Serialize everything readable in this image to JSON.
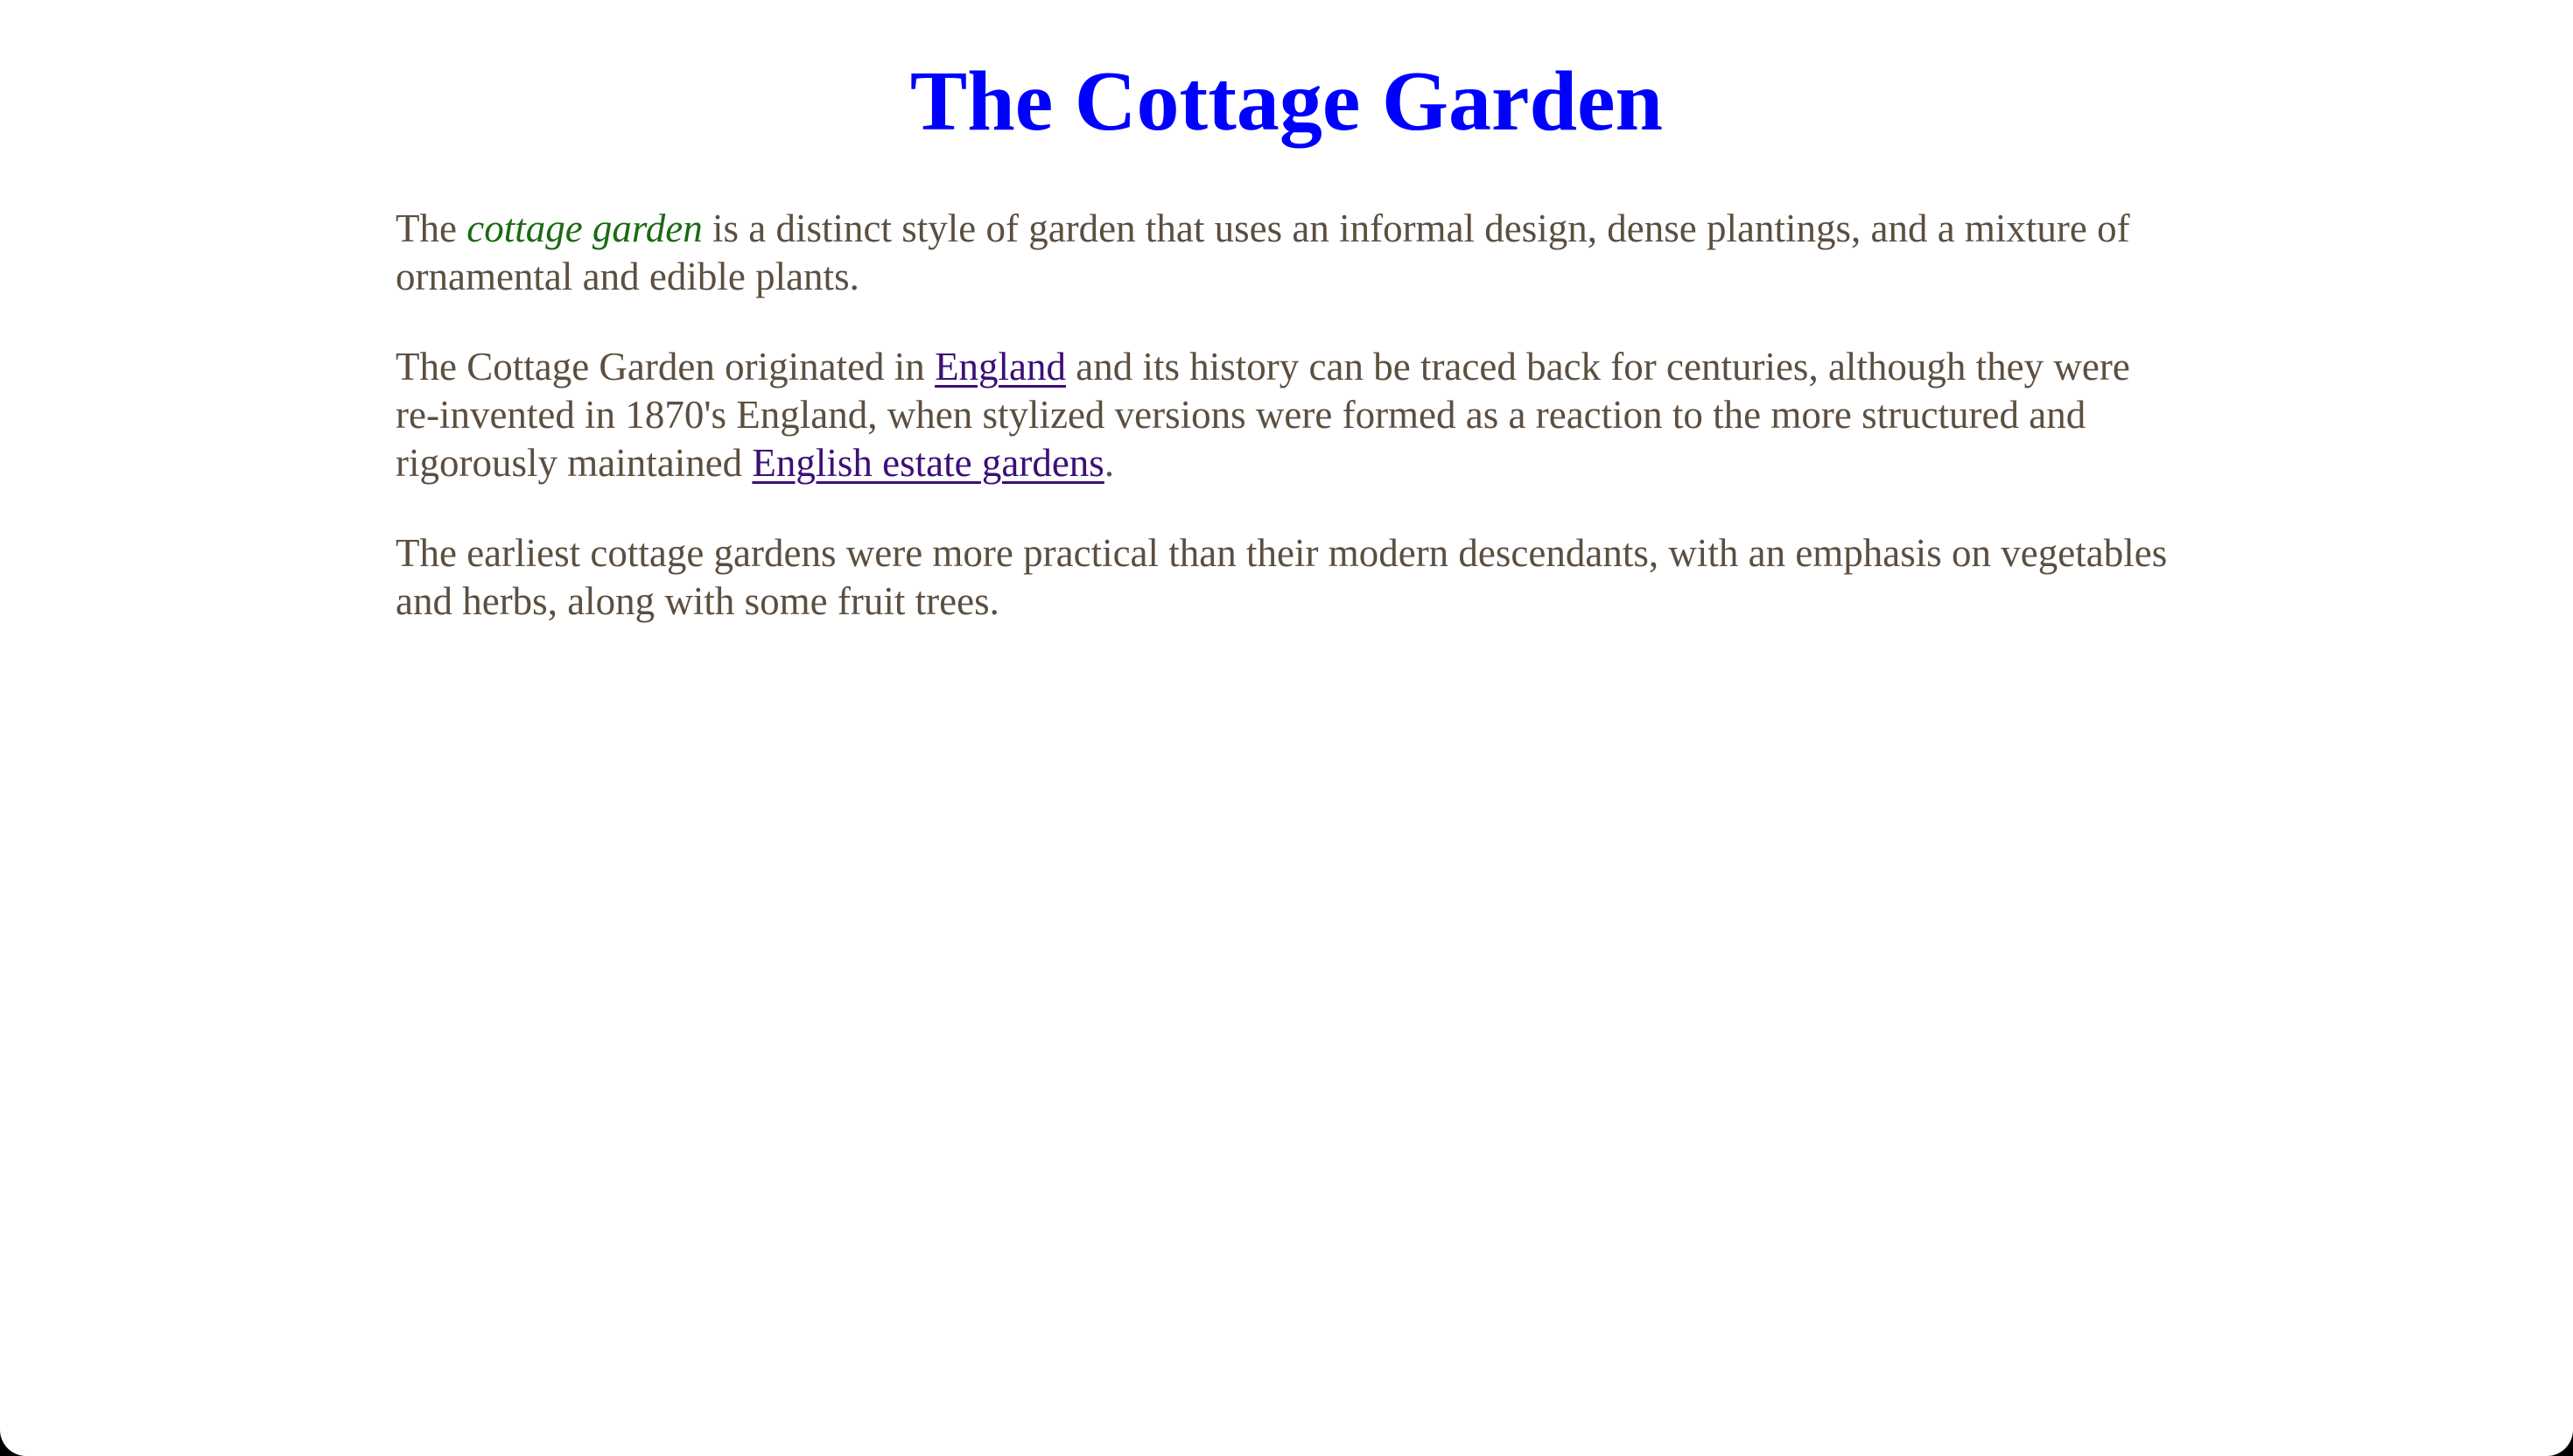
{
  "page": {
    "title": "The Cottage Garden",
    "colors": {
      "title": "#0000ff",
      "body_text": "#5c4f40",
      "emphasis": "#1b6a12",
      "link": "#3d0e78",
      "background": "#ffffff"
    }
  },
  "paragraphs": [
    {
      "part1": "The ",
      "emphasis": "cottage garden",
      "part2": " is a distinct style of garden that uses an informal design, dense plantings, and a mixture of ornamental and edible plants."
    },
    {
      "part1": "The Cottage Garden originated in ",
      "link1": "England",
      "part2": " and its history can be traced back for centuries, although they were re-invented in 1870's England, when stylized versions were formed as a reaction to the more structured and rigorously maintained ",
      "link2": "English estate gardens",
      "part3": "."
    },
    {
      "text": "The earliest cottage gardens were more practical than their modern descendants, with an emphasis on vegetables and herbs, along with some fruit trees."
    }
  ]
}
